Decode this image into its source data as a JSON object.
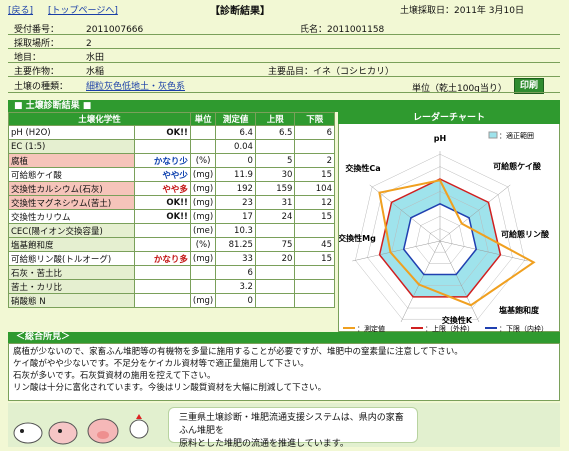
{
  "nav": {
    "back": "[戻る]",
    "top": "[トップページへ]"
  },
  "title": "【診断結果】",
  "analysis_date_label": "土壌採取日：",
  "analysis_date": "2011年 3月10日",
  "info": {
    "reception_label": "受付番号：",
    "reception": "2011007666",
    "name_label": "氏名：",
    "name": "2011001158",
    "site_label": "採取場所：",
    "site": "2",
    "land_label": "地目：",
    "land": "水田",
    "crop_label": "主要作物：",
    "crop": "水稲",
    "variety_label": "主要品目：",
    "variety": "イネ（コシヒカリ）",
    "soil_label": "土壌の種類：",
    "soil": "細粒灰色低地土・灰色系",
    "unit_label": "単位（乾土100g当り）",
    "print_label": "印刷"
  },
  "section_title": "■ 土壌診断結果 ■",
  "table_headers": [
    "土壌化学性",
    "単位",
    "測定値",
    "上限",
    "下限"
  ],
  "rows": [
    {
      "name": "pH (H2O)",
      "judge": "OK!!",
      "jclass": "j-ok",
      "unit": "",
      "value": "6.4",
      "upper": "6.5",
      "lower": "6",
      "style": ""
    },
    {
      "name": "EC (1:5)",
      "judge": "",
      "jclass": "",
      "unit": "",
      "value": "0.04",
      "upper": "",
      "lower": "",
      "style": "gr"
    },
    {
      "name": "腐植",
      "judge": "かなり少",
      "jclass": "j-few",
      "unit": "(%)",
      "value": "0",
      "upper": "5",
      "lower": "2",
      "style": "hl"
    },
    {
      "name": "可給態ケイ酸",
      "judge": "やや少",
      "jclass": "j-lit",
      "unit": "(mg)",
      "value": "11.9",
      "upper": "30",
      "lower": "15",
      "style": ""
    },
    {
      "name": "交換性カルシウム(石灰)",
      "judge": "やや多",
      "jclass": "j-much",
      "unit": "(mg)",
      "value": "192",
      "upper": "159",
      "lower": "104",
      "style": "hl"
    },
    {
      "name": "交換性マグネシウム(苦土)",
      "judge": "OK!!",
      "jclass": "j-ok",
      "unit": "(mg)",
      "value": "23",
      "upper": "31",
      "lower": "12",
      "style": "hl"
    },
    {
      "name": "交換性カリウム",
      "judge": "OK!!",
      "jclass": "j-ok",
      "unit": "(mg)",
      "value": "17",
      "upper": "24",
      "lower": "15",
      "style": ""
    },
    {
      "name": "CEC(陽イオン交換容量)",
      "judge": "",
      "jclass": "",
      "unit": "(me)",
      "value": "10.3",
      "upper": "",
      "lower": "",
      "style": "gr"
    },
    {
      "name": "塩基飽和度",
      "judge": "",
      "jclass": "",
      "unit": "(%)",
      "value": "81.25",
      "upper": "75",
      "lower": "45",
      "style": "gr"
    },
    {
      "name": "可給態リン酸(トルオーグ)",
      "judge": "かなり多",
      "jclass": "j-much",
      "unit": "(mg)",
      "value": "33",
      "upper": "20",
      "lower": "15",
      "style": ""
    },
    {
      "name": "石灰・苦土比",
      "judge": "",
      "jclass": "",
      "unit": "",
      "value": "6",
      "upper": "",
      "lower": "",
      "style": "gr"
    },
    {
      "name": "苦土・カリ比",
      "judge": "",
      "jclass": "",
      "unit": "",
      "value": "3.2",
      "upper": "",
      "lower": "",
      "style": "gr"
    },
    {
      "name": "硝酸態 N",
      "judge": "",
      "jclass": "",
      "unit": "(mg)",
      "value": "0",
      "upper": "",
      "lower": "",
      "style": "gr"
    }
  ],
  "chart": {
    "title": "レーダーチャート",
    "axes": [
      "pH",
      "可給態ケイ酸",
      "可給態リン酸",
      "塩基飽和度",
      "交換性K",
      "交換性Mg",
      "交換性Ca"
    ],
    "legend_range": "：適正範囲",
    "legend_measured": "：測定値",
    "legend_upper": "：上限（外枠）",
    "legend_lower": "：下限（内枠）",
    "colors": {
      "measured": "#f0a020",
      "upper": "#d02020",
      "lower": "#2040b0",
      "range": "#9fe3ec"
    }
  },
  "chart_data": {
    "type": "radar",
    "categories": [
      "pH",
      "可給態ケイ酸",
      "可給態リン酸",
      "塩基飽和度",
      "交換性K",
      "交換性Mg",
      "交換性Ca"
    ],
    "series": [
      {
        "name": "測定値",
        "values": [
          0.98,
          0.45,
          1.55,
          1.15,
          0.78,
          0.82,
          1.25
        ]
      },
      {
        "name": "上限（外枠）",
        "values": [
          1.0,
          1.0,
          1.0,
          1.0,
          1.0,
          1.0,
          1.0
        ]
      },
      {
        "name": "下限（内枠）",
        "values": [
          0.6,
          0.6,
          0.6,
          0.6,
          0.6,
          0.6,
          0.6
        ]
      }
    ]
  },
  "remarks_title": "＜総合所見＞",
  "remarks": [
    "腐植が少ないので、家畜ふん堆肥等の有機物を多量に施用することが必要ですが、堆肥中の窒素量に注意して下さい。",
    "ケイ酸がやや少ないです。不足分をケイカル資材等で適正量施用して下さい。",
    "石灰が多いです。石灰質資材の施用を控えて下さい。",
    "リン酸は十分に富化されています。今後はリン酸質資材を大幅に削減して下さい。"
  ],
  "footer": {
    "line1": "三重県土壌診断・堆肥流通支援システムは、県内の家畜ふん堆肥を",
    "line2": "原料とした堆肥の流通を推進しています。"
  }
}
